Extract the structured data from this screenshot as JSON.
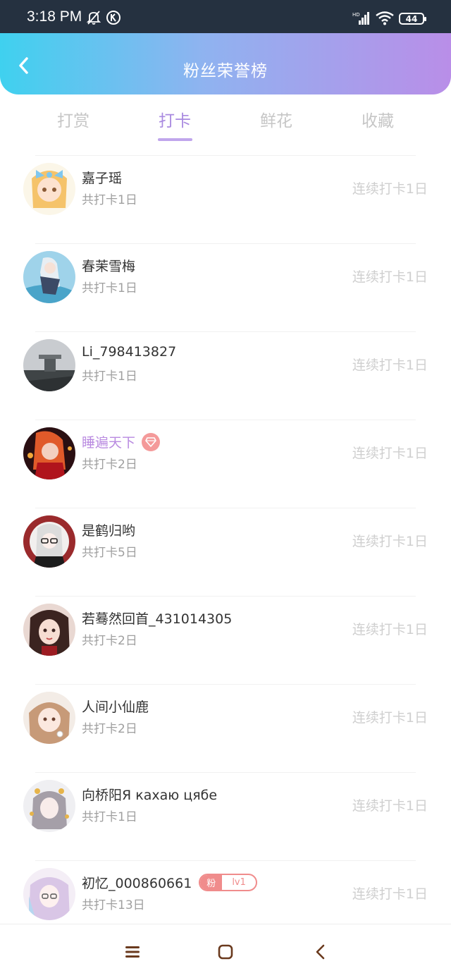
{
  "status_bar": {
    "time": "3:18 PM",
    "battery": "44",
    "icons": [
      "bell-off-icon",
      "k-circle-icon",
      "hd-signal-icon",
      "wifi-icon",
      "battery-icon"
    ]
  },
  "header": {
    "title": "粉丝荣誉榜",
    "back_icon": "chevron-left-icon"
  },
  "tabs": [
    {
      "label": "打赏",
      "active": false
    },
    {
      "label": "打卡",
      "active": true
    },
    {
      "label": "鲜花",
      "active": false
    },
    {
      "label": "收藏",
      "active": false
    }
  ],
  "list": [
    {
      "name": "嘉子瑶",
      "total": "共打卡1日",
      "streak": "连续打卡1日"
    },
    {
      "name": "春茉雪梅",
      "total": "共打卡1日",
      "streak": "连续打卡1日"
    },
    {
      "name": "Li_798413827",
      "total": "共打卡1日",
      "streak": "连续打卡1日"
    },
    {
      "name": "睡遍天下",
      "total": "共打卡2日",
      "streak": "连续打卡1日",
      "badge": "diamond-icon",
      "vip": true
    },
    {
      "name": "是鹤归哟",
      "total": "共打卡5日",
      "streak": "连续打卡1日"
    },
    {
      "name": "若蓦然回首_431014305",
      "total": "共打卡2日",
      "streak": "连续打卡1日"
    },
    {
      "name": "人间小仙鹿",
      "total": "共打卡2日",
      "streak": "连续打卡1日"
    },
    {
      "name": "向桥阳Я кахаю цябе",
      "total": "共打卡1日",
      "streak": "连续打卡1日"
    },
    {
      "name": "初忆_000860661",
      "total": "共打卡13日",
      "streak": "连续打卡1日",
      "fan_badge": {
        "fan": "粉",
        "level": "lv1"
      }
    }
  ],
  "nav": {
    "menu_icon": "menu-icon",
    "home_icon": "home-square-icon",
    "back_icon": "back-triangle-icon"
  },
  "colors": {
    "gradient_start": "#3fd1ef",
    "gradient_end": "#b98ee8",
    "accent": "#a98ae0",
    "badge_red": "#f08c8c"
  }
}
